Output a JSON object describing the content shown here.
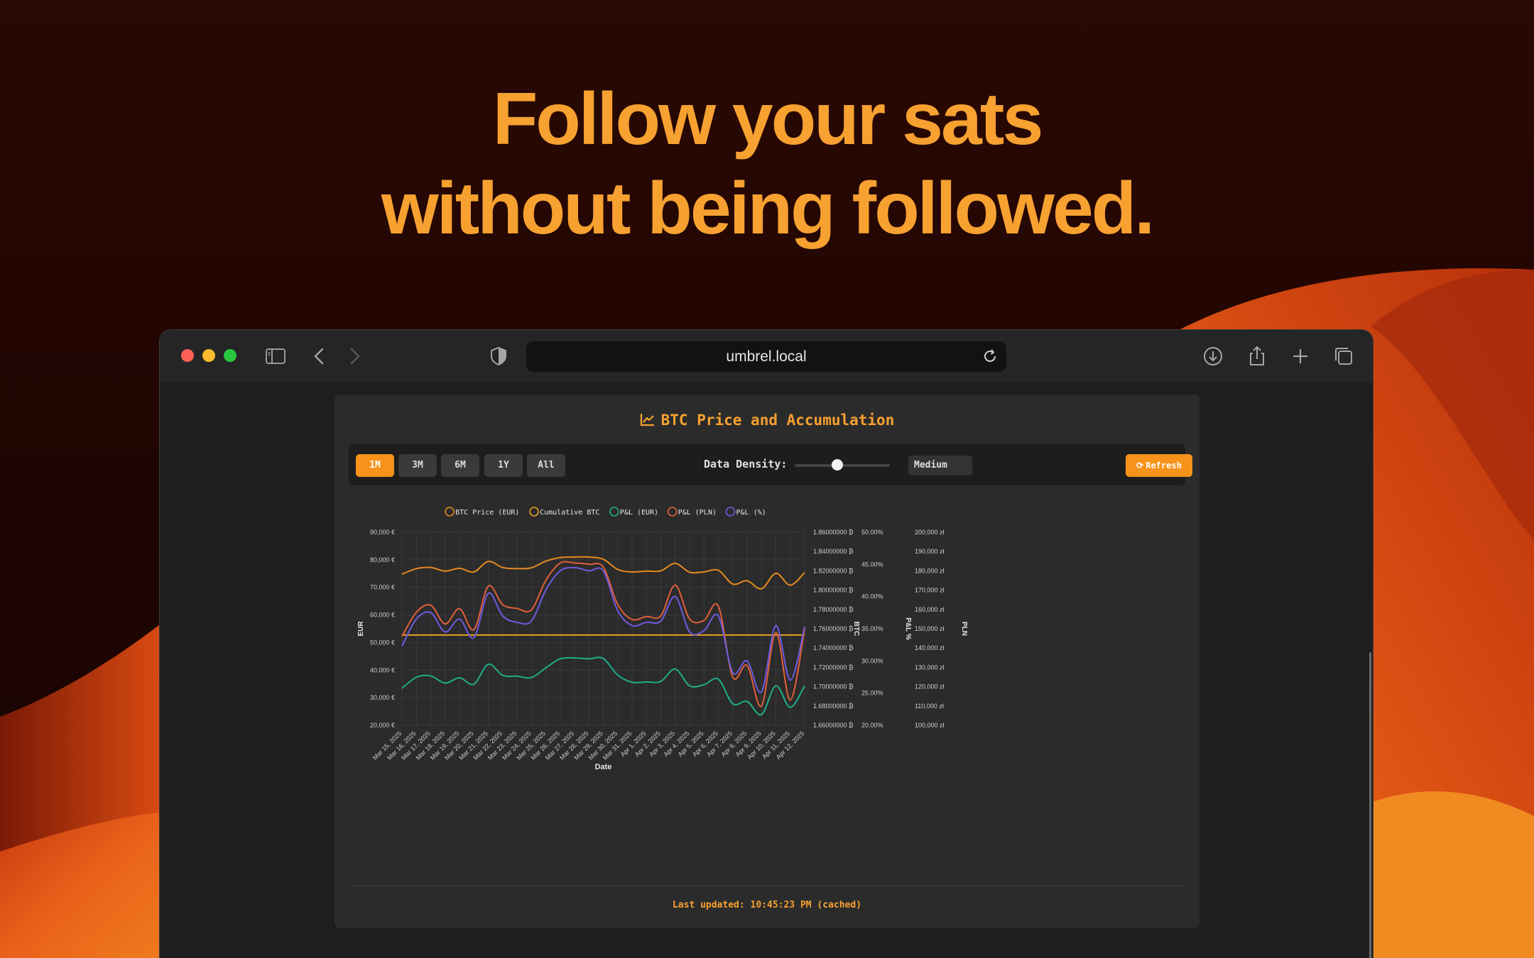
{
  "hero": {
    "line1": "Follow your sats",
    "line2": "without being followed."
  },
  "browser": {
    "url": "umbrel.local",
    "icons": [
      "sidebar-icon",
      "back-chevron-icon",
      "forward-chevron-icon",
      "shield-icon",
      "reload-icon",
      "download-icon",
      "share-icon",
      "new-tab-plus-icon",
      "tabs-overview-icon"
    ]
  },
  "card": {
    "title": "BTC Price and Accumulation",
    "title_icon": "chart-line-icon",
    "ranges": [
      "1M",
      "3M",
      "6M",
      "1Y",
      "All"
    ],
    "active_range": "1M",
    "density_label": "Data Density:",
    "density_value": "Medium",
    "density_level": 0.45,
    "refresh_label": "Refresh",
    "refresh_icon": "sync-icon",
    "footer": "Last updated: 10:45:23 PM (cached)"
  },
  "colors": {
    "accent": "#f7931a",
    "hero": "#f7a131",
    "btc_price": "#e68a1f",
    "cumulative": "#e8a020",
    "pnl_eur": "#1fae8a",
    "pnl_pln": "#e0603a",
    "pnl_pct": "#6f5ce0"
  },
  "chart_data": {
    "type": "line",
    "xlabel": "Date",
    "categories": [
      "Mar 15, 2025",
      "Mar 16, 2025",
      "Mar 17, 2025",
      "Mar 18, 2025",
      "Mar 19, 2025",
      "Mar 20, 2025",
      "Mar 21, 2025",
      "Mar 22, 2025",
      "Mar 23, 2025",
      "Mar 24, 2025",
      "Mar 25, 2025",
      "Mar 26, 2025",
      "Mar 27, 2025",
      "Mar 28, 2025",
      "Mar 29, 2025",
      "Mar 30, 2025",
      "Mar 31, 2025",
      "Apr 1, 2025",
      "Apr 2, 2025",
      "Apr 3, 2025",
      "Apr 4, 2025",
      "Apr 5, 2025",
      "Apr 6, 2025",
      "Apr 7, 2025",
      "Apr 8, 2025",
      "Apr 9, 2025",
      "Apr 10, 2025",
      "Apr 11, 2025",
      "Apr 12, 2025"
    ],
    "axes": {
      "EUR": {
        "label": "EUR",
        "position": "left",
        "min": 20000,
        "max": 90000,
        "step": 10000,
        "ticks": [
          "20,000 €",
          "30,000 €",
          "40,000 €",
          "50,000 €",
          "60,000 €",
          "70,000 €",
          "80,000 €",
          "90,000 €"
        ]
      },
      "BTC": {
        "label": "BTC",
        "position": "right",
        "min": 1.66,
        "max": 1.86,
        "step": 0.02,
        "ticks": [
          "1.66000000 ₿",
          "1.68000000 ₿",
          "1.70000000 ₿",
          "1.72000000 ₿",
          "1.74000000 ₿",
          "1.76000000 ₿",
          "1.78000000 ₿",
          "1.80000000 ₿",
          "1.82000000 ₿",
          "1.84000000 ₿",
          "1.86000000 ₿"
        ]
      },
      "PCT": {
        "label": "P&L %",
        "position": "right",
        "min": 20,
        "max": 50,
        "step": 5,
        "ticks": [
          "20.00%",
          "25.00%",
          "30.00%",
          "35.00%",
          "40.00%",
          "45.00%",
          "50.00%"
        ]
      },
      "PLN": {
        "label": "PLN",
        "position": "right",
        "min": 100000,
        "max": 200000,
        "step": 10000,
        "ticks": [
          "100,000 zł",
          "110,000 zł",
          "120,000 zł",
          "130,000 zł",
          "140,000 zł",
          "150,000 zł",
          "160,000 zł",
          "170,000 zł",
          "180,000 zł",
          "190,000 zł",
          "200,000 zł"
        ]
      }
    },
    "grid": true,
    "legend_position": "top-center",
    "series": [
      {
        "name": "BTC Price (EUR)",
        "axis": "EUR",
        "color": "#e68a1f",
        "values": [
          74800,
          76800,
          77200,
          75900,
          76900,
          75600,
          79400,
          77200,
          76800,
          77100,
          79500,
          80800,
          81000,
          81000,
          80200,
          76500,
          75600,
          75900,
          76000,
          78700,
          75500,
          75600,
          76200,
          71200,
          72400,
          69500,
          75100,
          70800,
          75400
        ]
      },
      {
        "name": "Cumulative BTC",
        "axis": "BTC",
        "color": "#e8a020",
        "values": [
          1.7535,
          1.7535,
          1.7535,
          1.7535,
          1.7535,
          1.7535,
          1.7535,
          1.7535,
          1.7535,
          1.7535,
          1.7535,
          1.7535,
          1.7535,
          1.7535,
          1.7535,
          1.7535,
          1.7535,
          1.7535,
          1.7535,
          1.7535,
          1.7535,
          1.7535,
          1.7535,
          1.7535,
          1.7535,
          1.7535,
          1.7535,
          1.7535,
          1.7535
        ]
      },
      {
        "name": "P&L (EUR)",
        "axis": "EUR",
        "color": "#1fae8a",
        "values": [
          33400,
          37400,
          37900,
          35300,
          37200,
          34900,
          42100,
          38100,
          37800,
          37300,
          40800,
          44100,
          44400,
          44100,
          44200,
          38200,
          35600,
          35700,
          35900,
          40400,
          34300,
          34700,
          36700,
          27800,
          28600,
          23900,
          34300,
          26500,
          34300
        ]
      },
      {
        "name": "P&L (PLN)",
        "axis": "PLN",
        "color": "#e0603a",
        "values": [
          146000,
          158500,
          162200,
          152500,
          160400,
          149500,
          172000,
          162500,
          160500,
          159800,
          175000,
          184000,
          184100,
          183400,
          181900,
          162600,
          154800,
          156300,
          156700,
          172600,
          155000,
          154300,
          161700,
          125000,
          131000,
          110000,
          148000,
          113000,
          150000
        ]
      },
      {
        "name": "P&L (%)",
        "axis": "PCT",
        "color": "#6f5ce0",
        "values": [
          32.3,
          36.5,
          37.5,
          34.5,
          36.5,
          33.6,
          40.5,
          37.0,
          36.0,
          36.2,
          41.0,
          44.0,
          44.5,
          44.0,
          44.0,
          37.8,
          35.5,
          36.0,
          36.2,
          40.0,
          34.5,
          34.7,
          37.0,
          28.2,
          30.0,
          25.2,
          35.5,
          27.0,
          35.3
        ]
      }
    ]
  }
}
